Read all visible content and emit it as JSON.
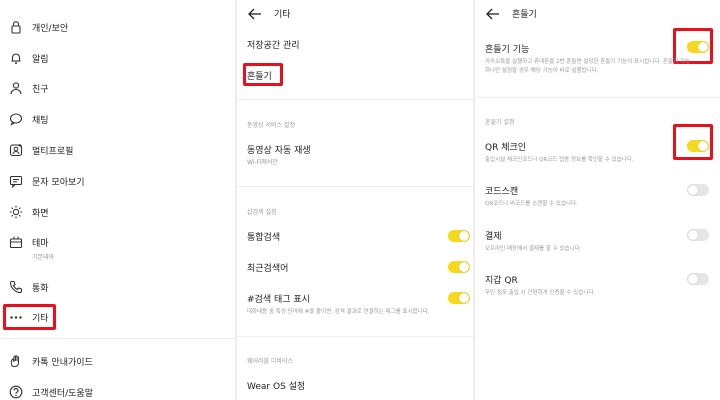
{
  "colors": {
    "accent_yellow": "#f6d81d",
    "highlight_red": "#e8101a",
    "toggle_off": "#e5e5e5"
  },
  "panel1": {
    "items": [
      {
        "label": "개인/보안",
        "icon": "lock-icon"
      },
      {
        "label": "알림",
        "icon": "bell-icon"
      },
      {
        "label": "친구",
        "icon": "person-icon"
      },
      {
        "label": "채팅",
        "icon": "chat-bubble-icon"
      },
      {
        "label": "멀티프로필",
        "icon": "multi-profile-icon"
      },
      {
        "label": "문자 모아보기",
        "icon": "message-collect-icon"
      },
      {
        "label": "화면",
        "icon": "brightness-icon"
      },
      {
        "label": "테마",
        "sublabel": "기본테마",
        "icon": "theme-icon"
      },
      {
        "label": "통화",
        "icon": "phone-icon"
      },
      {
        "label": "기타",
        "icon": "more-dots-icon"
      },
      {
        "label": "카톡 안내가이드",
        "icon": "guide-hand-icon"
      },
      {
        "label": "고객센터/도움말",
        "icon": "help-icon"
      }
    ]
  },
  "panel2": {
    "title": "기타",
    "rows": {
      "storage": "저장공간 관리",
      "shake": "흔들기",
      "video_section": "동영상 서비스 설정",
      "autoplay_title": "동영상 자동 재생",
      "autoplay_desc": "Wi-Fi에서만",
      "search_section": "샵검색 설정",
      "integrated_search": "통합검색",
      "recent_search": "최근검색어",
      "hashtag_title": "#검색 태그 표시",
      "hashtag_desc": "대화내용 중 특정 단어에 #을 붙이면, 검색 결과로 연결하는 태그를 표시합니다.",
      "wearable_section": "웨어러블 디바이스",
      "wearos": "Wear OS 설정"
    },
    "toggles": {
      "integrated_search": true,
      "recent_search": true,
      "hashtag": true
    }
  },
  "panel3": {
    "title": "흔들기",
    "shake_title": "흔들기 기능",
    "shake_desc_1": "카카오톡을 실행하고 휴대폰을 2번 흔들면 설정한 흔들기 기능이 표시됩니다. 흔들기 기능",
    "shake_desc_2": "하나만 설정할 경우 해당 기능이 바로 실행됩니다.",
    "settings_section": "흔들기 설정",
    "items": [
      {
        "title": "QR 체크인",
        "desc": "출입시설 체크인코드나 QR코드 접종 정보를 확인할 수 있습니다.",
        "on": true
      },
      {
        "title": "코드스캔",
        "desc": "QR코드나 바코드를 스캔할 수 있습니다.",
        "on": false
      },
      {
        "title": "결제",
        "desc": "오프라인 매장에서 결제를 할 수 있습니다.",
        "on": false
      },
      {
        "title": "지갑 QR",
        "desc": "무인 점포 출입 시 간편하게 인증할 수 있습니다.",
        "on": false
      }
    ],
    "shake_toggle_on": true
  }
}
